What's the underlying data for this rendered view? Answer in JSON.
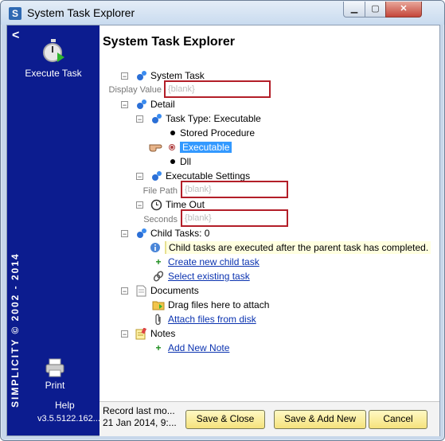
{
  "window": {
    "title": "System Task Explorer",
    "app_icon_letter": "S",
    "min_label": "▁",
    "max_label": "▢",
    "close_label": "✕"
  },
  "sidebar": {
    "chevron": "<",
    "execute_task_label": "Execute Task",
    "vertical_text": "SIMPLICITY © 2002 - 2014",
    "print_label": "Print",
    "help_label": "Help",
    "version": "v3.5.5122.162..."
  },
  "main": {
    "heading": "System Task Explorer",
    "tree": {
      "system_task": "System Task",
      "display_value_label": "Display Value",
      "display_value": "{blank}",
      "detail": "Detail",
      "task_type": "Task Type:  Executable",
      "options": [
        "Stored Procedure",
        "Executable",
        "Dll"
      ],
      "executable_settings": "Executable Settings",
      "file_path_label": "File Path",
      "file_path_value": "{blank}",
      "time_out": "Time Out",
      "seconds_label": "Seconds",
      "seconds_value": "{blank}",
      "child_tasks": "Child Tasks:  0",
      "child_info": "Child tasks are executed after the parent task has completed.",
      "create_child": "Create new child task",
      "select_existing": "Select existing task",
      "documents": "Documents",
      "drag_files": "Drag files here to attach",
      "attach_files": "Attach files from disk",
      "notes": "Notes",
      "add_note": "Add New Note"
    }
  },
  "footer": {
    "record_line1": "Record last mo...",
    "record_line2": "21 Jan 2014, 9:...",
    "save_close": "Save & Close",
    "save_add_new": "Save & Add New",
    "cancel": "Cancel"
  },
  "colors": {
    "sidebar_bg": "#0c1c8f",
    "field_border": "#b31e28",
    "link": "#0b33b0",
    "selection": "#3399ff"
  }
}
